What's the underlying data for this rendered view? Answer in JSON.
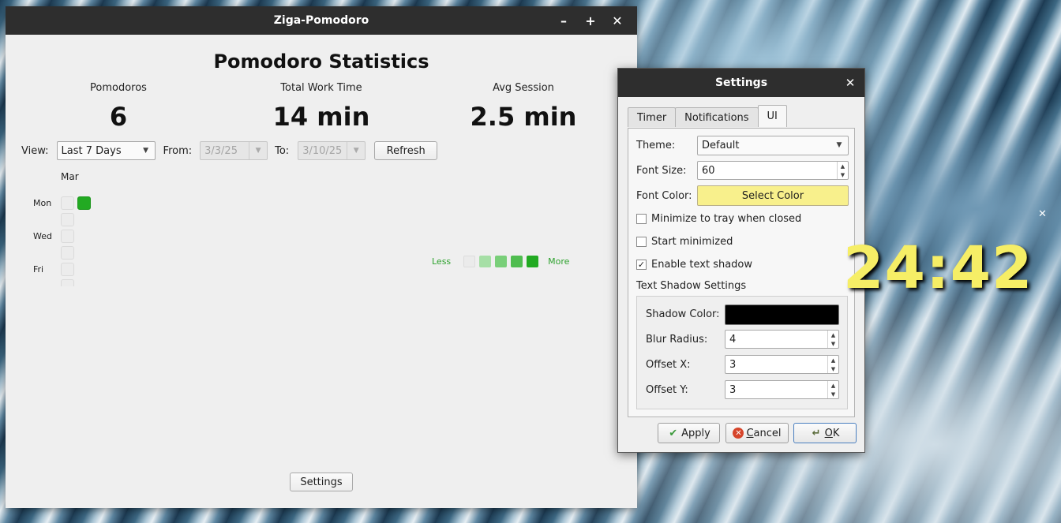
{
  "main_window": {
    "title": "Ziga-Pomodoro",
    "controls": {
      "minimize": "–",
      "maximize": "+",
      "close": "✕"
    },
    "heading": "Pomodoro Statistics",
    "stats": [
      {
        "label": "Pomodoros",
        "value": "6"
      },
      {
        "label": "Total Work Time",
        "value": "14 min"
      },
      {
        "label": "Avg Session",
        "value": "2.5 min"
      }
    ],
    "filters": {
      "view_label": "View:",
      "view_value": "Last 7 Days",
      "from_label": "From:",
      "from_value": "3/3/25",
      "to_label": "To:",
      "to_value": "3/10/25",
      "refresh": "Refresh"
    },
    "heatmap": {
      "month": "Mar",
      "day_labels": [
        "Mon",
        "Wed",
        "Fri"
      ],
      "legend_less": "Less",
      "legend_more": "More",
      "legend_colors": [
        "#ebebeb",
        "#a6dfa6",
        "#79cf79",
        "#4fbd4f",
        "#22aa22"
      ],
      "active_color": "#22aa22"
    },
    "settings_button": "Settings"
  },
  "settings_dialog": {
    "title": "Settings",
    "close": "✕",
    "tabs": [
      {
        "label": "Timer",
        "active": false
      },
      {
        "label": "Notifications",
        "active": false
      },
      {
        "label": "UI",
        "active": true
      }
    ],
    "theme_label": "Theme:",
    "theme_value": "Default",
    "font_size_label": "Font Size:",
    "font_size_value": "60",
    "font_color_label": "Font Color:",
    "font_color_button": "Select Color",
    "font_color": "#f8f08c",
    "checkboxes": [
      {
        "label": "Minimize to tray when closed",
        "checked": false
      },
      {
        "label": "Start minimized",
        "checked": false
      },
      {
        "label": "Enable text shadow",
        "checked": true
      }
    ],
    "shadow_section_title": "Text Shadow Settings",
    "shadow_color_label": "Shadow Color:",
    "shadow_color": "#000000",
    "blur_label": "Blur Radius:",
    "blur_value": "4",
    "offset_x_label": "Offset X:",
    "offset_x_value": "3",
    "offset_y_label": "Offset Y:",
    "offset_y_value": "3",
    "buttons": {
      "apply": "Apply",
      "cancel_prefix": "",
      "cancel_mnemonic": "C",
      "cancel_rest": "ancel",
      "ok_mnemonic": "O",
      "ok_rest": "K"
    }
  },
  "overlay": {
    "timer_text": "24:42",
    "close": "✕"
  }
}
